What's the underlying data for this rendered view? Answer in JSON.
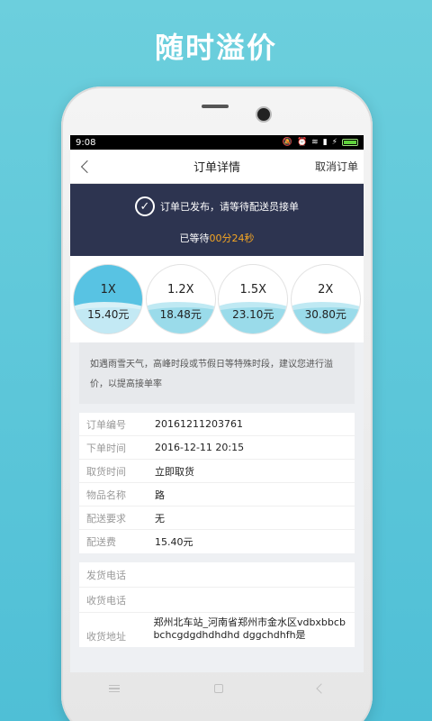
{
  "promo": {
    "title": "随时溢价"
  },
  "status_bar": {
    "time": "9:08"
  },
  "nav": {
    "title": "订单详情",
    "action": "取消订单"
  },
  "banner": {
    "message": "订单已发布，请等待配送员接单",
    "wait_prefix": "已等待",
    "wait_time": "00分24秒"
  },
  "premium_options": [
    {
      "multiplier": "1X",
      "price": "15.40元",
      "selected": true
    },
    {
      "multiplier": "1.2X",
      "price": "18.48元",
      "selected": false
    },
    {
      "multiplier": "1.5X",
      "price": "23.10元",
      "selected": false
    },
    {
      "multiplier": "2X",
      "price": "30.80元",
      "selected": false
    }
  ],
  "tip": "如遇雨雪天气，高峰时段或节假日等特殊时段，建议您进行溢价，以提高接单率",
  "order_details": [
    {
      "label": "订单编号",
      "value": "20161211203761"
    },
    {
      "label": "下单时间",
      "value": "2016-12-11 20:15"
    },
    {
      "label": "取货时间",
      "value": "立即取货"
    },
    {
      "label": "物品名称",
      "value": "路"
    },
    {
      "label": "配送要求",
      "value": "无"
    },
    {
      "label": "配送费",
      "value": "15.40元"
    }
  ],
  "contact": {
    "sender_phone_label": "发货电话",
    "receiver_phone_label": "收货电话",
    "address_label": "收货地址",
    "address_value": "郑州北车站_河南省郑州市金水区vdbxbbcbbchcgdgdhdhdhd dggchdhfh是"
  },
  "colors": {
    "accent": "#58c3e3",
    "banner_bg": "#2d3450",
    "timer": "#f5a623"
  }
}
